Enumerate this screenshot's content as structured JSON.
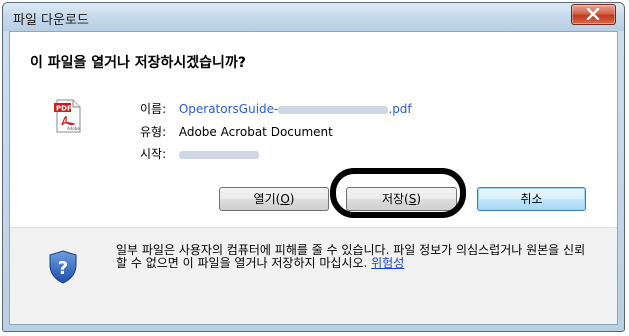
{
  "window": {
    "title": "파일 다운로드"
  },
  "dialog": {
    "question": "이 파일을 열거나 저장하시겠습니까?",
    "file": {
      "icon": "pdf-file-icon",
      "name_label": "이름:",
      "name_prefix": "OperatorsGuide-",
      "name_suffix": ".pdf",
      "type_label": "유형:",
      "type_value": "Adobe Acrobat Document",
      "from_label": "시작:"
    },
    "buttons": {
      "open": "열기(",
      "open_key": "O",
      "open_end": ")",
      "save": "저장(",
      "save_key": "S",
      "save_end": ")",
      "cancel": "취소"
    },
    "warning": {
      "icon": "shield-question-icon",
      "text": "일부 파일은 사용자의 컴퓨터에 피해를 줄 수 있습니다. 파일 정보가 의심스럽거나 원본을 신뢰할 수 없으면 이 파일을 열거나 저장하지 마십시오. ",
      "link": "위험성"
    }
  },
  "colors": {
    "close_button": "#c0391d",
    "link": "#2a5bd7",
    "highlight_ring": "#000000"
  }
}
